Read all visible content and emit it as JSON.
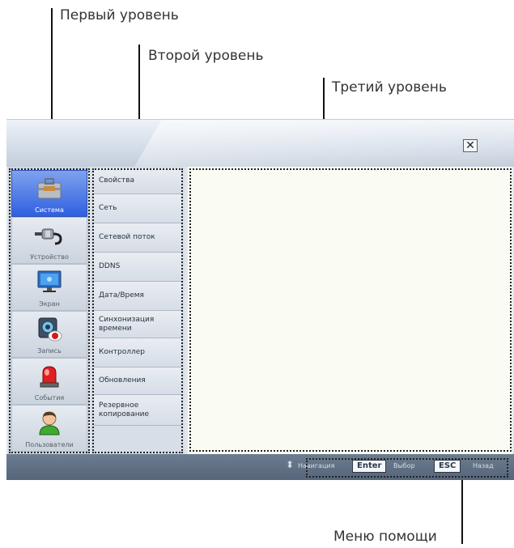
{
  "callouts": {
    "level1": "Первый уровень",
    "level2": "Второй уровень",
    "level3": "Третий уровень",
    "help": "Меню помощи"
  },
  "window": {
    "close_glyph": "✕"
  },
  "level1_items": [
    {
      "label": "Система",
      "icon": "toolbox-icon",
      "active": true
    },
    {
      "label": "Устройство",
      "icon": "cable-icon",
      "active": false
    },
    {
      "label": "Экран",
      "icon": "monitor-icon",
      "active": false
    },
    {
      "label": "Запись",
      "icon": "record-icon",
      "active": false
    },
    {
      "label": "События",
      "icon": "alarm-light-icon",
      "active": false
    },
    {
      "label": "Пользователи",
      "icon": "user-icon",
      "active": false
    }
  ],
  "level2_items": [
    "Свойства",
    "Сеть",
    "Сетевой поток",
    "DDNS",
    "Дата/Время",
    "Синхонизация времени",
    "Контроллер",
    "Обновления",
    "Резервное копирование"
  ],
  "help_menu": {
    "nav_glyph": "⬍",
    "nav_label": "Навигация",
    "enter_key": "Enter",
    "enter_label": "Выбор",
    "esc_key": "ESC",
    "esc_label": "Назад"
  },
  "colors": {
    "active_item": "#2f5fe0",
    "footer": "#5f6e82",
    "content_bg": "#fafbf2"
  }
}
